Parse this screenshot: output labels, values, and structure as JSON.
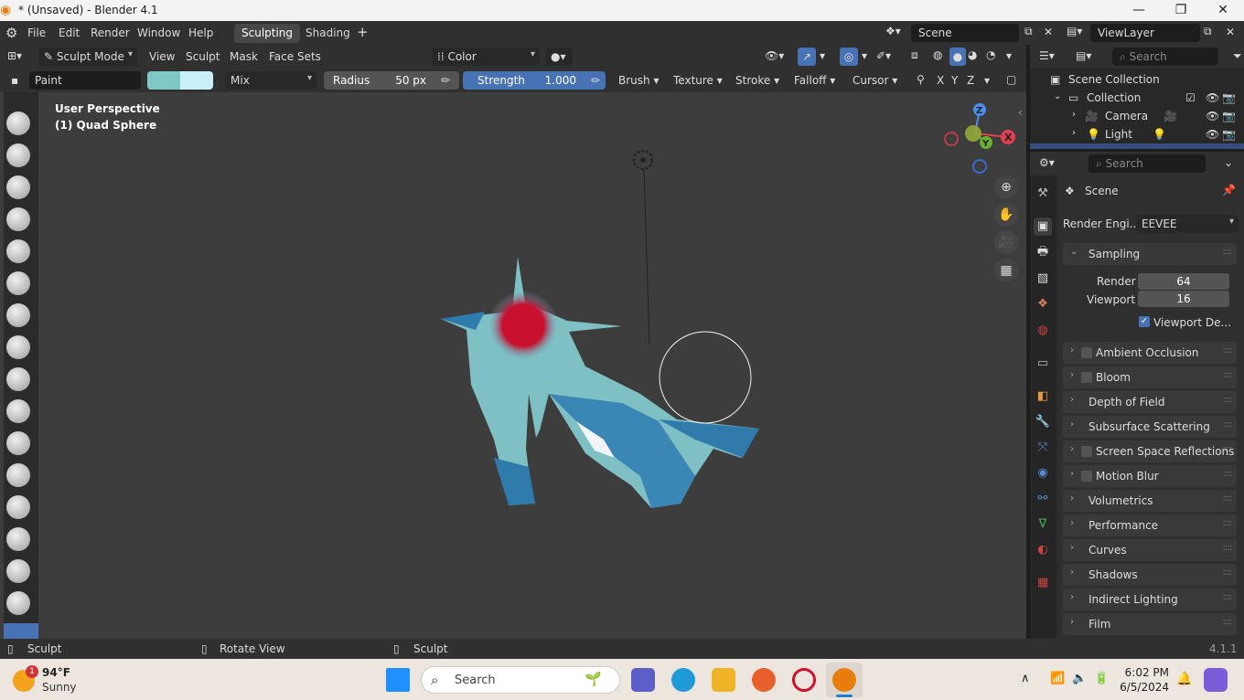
{
  "window": {
    "title": "* (Unsaved) - Blender 4.1",
    "minimize": "—",
    "maximize": "❐",
    "close": "✕"
  },
  "menu": {
    "items": [
      "File",
      "Edit",
      "Render",
      "Window",
      "Help"
    ]
  },
  "workspaces": {
    "tabs": [
      "Sculpting",
      "Shading"
    ],
    "active": "Sculpting",
    "add": "+"
  },
  "scene_selector": {
    "value": "Scene"
  },
  "viewlayer_selector": {
    "value": "ViewLayer"
  },
  "header": {
    "mode": "Sculpt Mode",
    "menus": [
      "View",
      "Sculpt",
      "Mask",
      "Face Sets"
    ],
    "color_attr": "Color"
  },
  "tool_settings": {
    "brush_name": "Paint",
    "blend": "Mix",
    "radius_label": "Radius",
    "radius_value": "50 px",
    "strength_label": "Strength",
    "strength_value": "1.000",
    "menus": [
      "Brush",
      "Texture",
      "Stroke",
      "Falloff",
      "Cursor"
    ],
    "axes": [
      "X",
      "Y",
      "Z"
    ]
  },
  "colors": {
    "primary": "#80c8c8",
    "secondary": "#c8f0f8",
    "accent": "#4772b3",
    "brush_red": "#c8102e"
  },
  "viewport": {
    "line1": "User Perspective",
    "line2": "(1) Quad Sphere"
  },
  "gizmo": {
    "x": "X",
    "y": "Y",
    "z": "Z"
  },
  "outliner": {
    "search_placeholder": "Search",
    "root": "Scene Collection",
    "collection": "Collection",
    "items": [
      "Camera",
      "Light"
    ]
  },
  "properties": {
    "search_placeholder": "Search",
    "context": "Scene",
    "render_engine_label": "Render Engi...",
    "render_engine_value": "EEVEE",
    "sampling": {
      "title": "Sampling",
      "render_label": "Render",
      "render_value": "64",
      "viewport_label": "Viewport",
      "viewport_value": "16",
      "denoise_label": "Viewport De..."
    },
    "panels": [
      {
        "label": "Ambient Occlusion",
        "checkbox": true
      },
      {
        "label": "Bloom",
        "checkbox": true
      },
      {
        "label": "Depth of Field",
        "checkbox": false
      },
      {
        "label": "Subsurface Scattering",
        "checkbox": false
      },
      {
        "label": "Screen Space Reflections",
        "checkbox": true
      },
      {
        "label": "Motion Blur",
        "checkbox": true
      },
      {
        "label": "Volumetrics",
        "checkbox": false
      },
      {
        "label": "Performance",
        "checkbox": false
      },
      {
        "label": "Curves",
        "checkbox": false
      },
      {
        "label": "Shadows",
        "checkbox": false
      },
      {
        "label": "Indirect Lighting",
        "checkbox": false
      },
      {
        "label": "Film",
        "checkbox": false
      }
    ]
  },
  "status": {
    "left": "Sculpt",
    "middle": "Rotate View",
    "right": "Sculpt",
    "version": "4.1.1"
  },
  "taskbar": {
    "weather_temp": "94°F",
    "weather_desc": "Sunny",
    "weather_badge": "1",
    "search": "Search",
    "time": "6:02 PM",
    "date": "6/5/2024"
  }
}
